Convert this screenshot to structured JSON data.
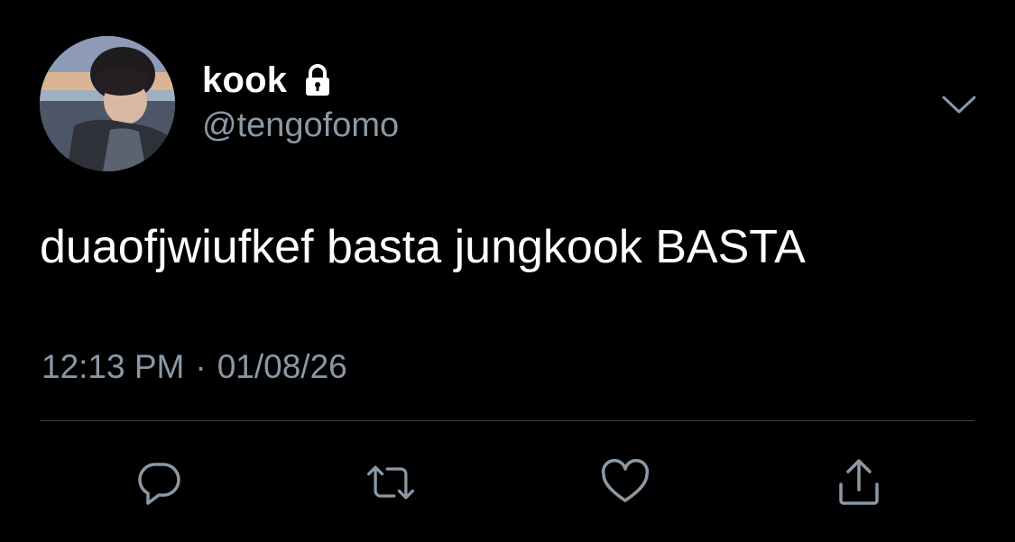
{
  "user": {
    "display_name": "kook",
    "handle": "@tengofomo",
    "protected_icon": "lock-icon"
  },
  "tweet": {
    "text": "duaofjwiufkef basta jungkook BASTA",
    "time": "12:13 PM",
    "separator": "·",
    "date": "01/08/26"
  },
  "actions": [
    {
      "name": "reply",
      "icon": "reply-icon"
    },
    {
      "name": "retweet",
      "icon": "retweet-icon"
    },
    {
      "name": "like",
      "icon": "heart-icon"
    },
    {
      "name": "share",
      "icon": "share-icon"
    }
  ],
  "colors": {
    "background": "#000000",
    "primary_text": "#ffffff",
    "secondary_text": "#8b98a5",
    "divider": "#38444d",
    "icon": "#8b98a5"
  }
}
